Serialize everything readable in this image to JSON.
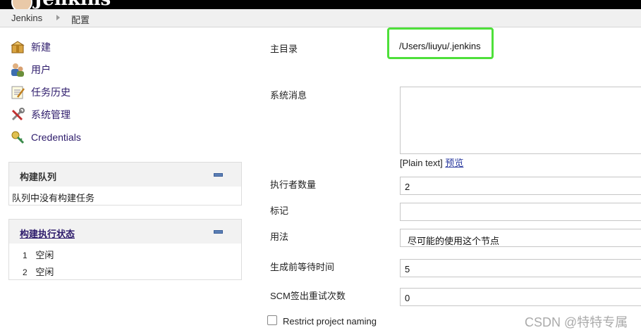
{
  "header": {
    "logo_text": "Jenkins"
  },
  "breadcrumb": [
    "Jenkins",
    "配置"
  ],
  "sidebar": {
    "tasks": [
      {
        "label": "新建",
        "icon": "new-item-icon"
      },
      {
        "label": "用户",
        "icon": "users-icon"
      },
      {
        "label": "任务历史",
        "icon": "notepad-icon"
      },
      {
        "label": "系统管理",
        "icon": "tools-icon"
      },
      {
        "label": "Credentials",
        "icon": "key-icon"
      }
    ],
    "build_queue": {
      "title": "构建队列",
      "empty": "队列中没有构建任务"
    },
    "executors": {
      "title": "构建执行状态",
      "rows": [
        {
          "num": "1",
          "status": "空闲"
        },
        {
          "num": "2",
          "status": "空闲"
        }
      ]
    }
  },
  "form": {
    "home_dir": {
      "label": "主目录",
      "value": "/Users/liuyu/.jenkins"
    },
    "system_message": {
      "label": "系统消息",
      "value": "",
      "help_prefix": "[Plain text]",
      "preview": "预览"
    },
    "executors": {
      "label": "执行者数量",
      "value": "2"
    },
    "labels": {
      "label": "标记",
      "value": ""
    },
    "usage": {
      "label": "用法",
      "value": "尽可能的使用这个节点"
    },
    "quiet_period": {
      "label": "生成前等待时间",
      "value": "5"
    },
    "scm_retry": {
      "label": "SCM签出重试次数",
      "value": "0"
    },
    "restrict_naming": {
      "label": "Restrict project naming",
      "checked": false
    }
  },
  "watermark": "CSDN @特特专属",
  "colors": {
    "highlight": "#4ee03a",
    "link": "#2d1b6b",
    "topbar": "#000000"
  }
}
